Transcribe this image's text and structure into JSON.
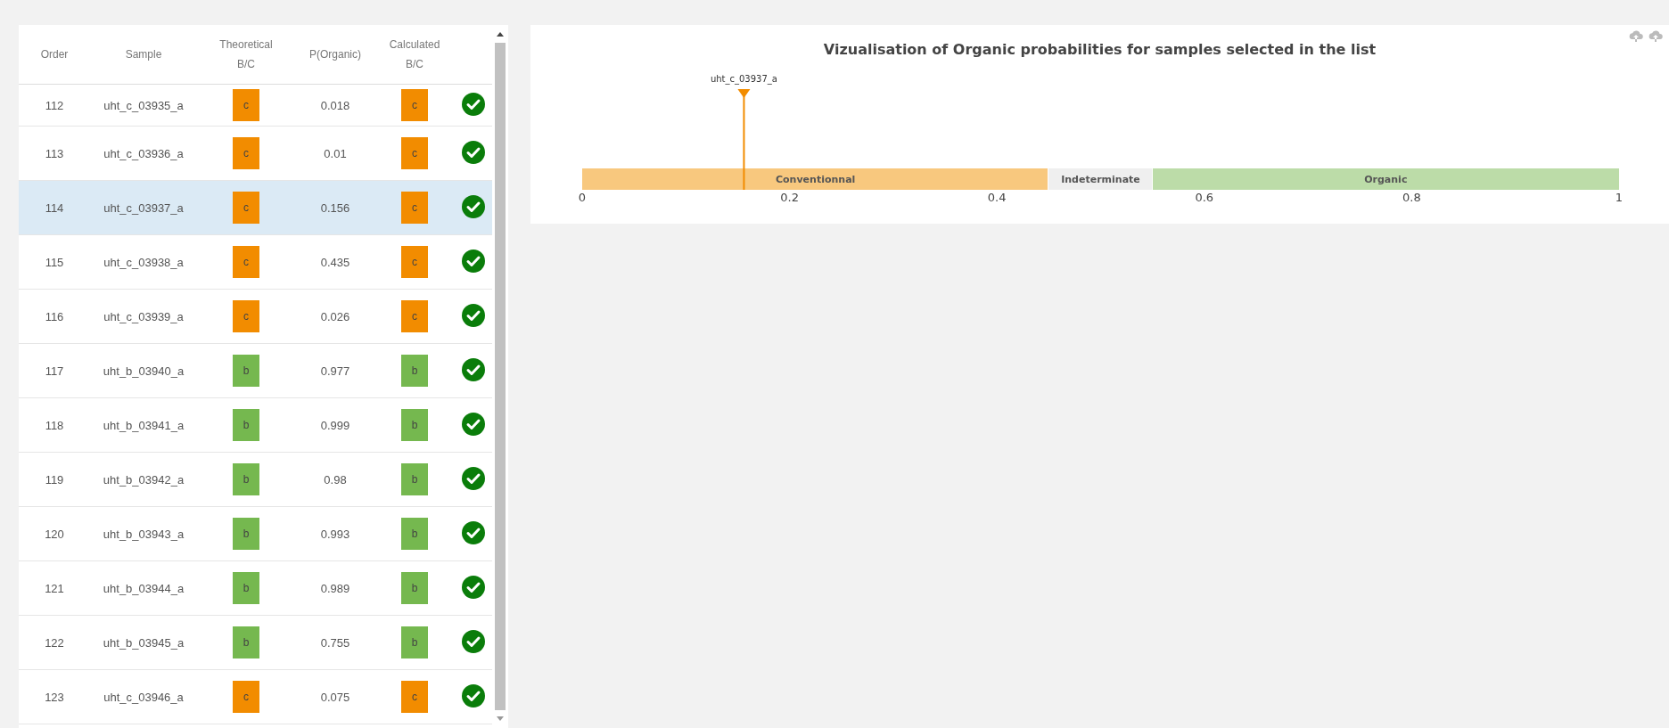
{
  "table": {
    "columns": [
      {
        "label": "Order"
      },
      {
        "label": "Sample"
      },
      {
        "label": "Theoretical B/C"
      },
      {
        "label": "P(Organic)"
      },
      {
        "label": "Calculated B/C"
      }
    ],
    "rows": [
      {
        "order": "112",
        "sample": "uht_c_03935_a",
        "theoretical": "c",
        "p_organic": "0.018",
        "calculated": "c",
        "match": true,
        "selected": false
      },
      {
        "order": "113",
        "sample": "uht_c_03936_a",
        "theoretical": "c",
        "p_organic": "0.01",
        "calculated": "c",
        "match": true,
        "selected": false
      },
      {
        "order": "114",
        "sample": "uht_c_03937_a",
        "theoretical": "c",
        "p_organic": "0.156",
        "calculated": "c",
        "match": true,
        "selected": true
      },
      {
        "order": "115",
        "sample": "uht_c_03938_a",
        "theoretical": "c",
        "p_organic": "0.435",
        "calculated": "c",
        "match": true,
        "selected": false
      },
      {
        "order": "116",
        "sample": "uht_c_03939_a",
        "theoretical": "c",
        "p_organic": "0.026",
        "calculated": "c",
        "match": true,
        "selected": false
      },
      {
        "order": "117",
        "sample": "uht_b_03940_a",
        "theoretical": "b",
        "p_organic": "0.977",
        "calculated": "b",
        "match": true,
        "selected": false
      },
      {
        "order": "118",
        "sample": "uht_b_03941_a",
        "theoretical": "b",
        "p_organic": "0.999",
        "calculated": "b",
        "match": true,
        "selected": false
      },
      {
        "order": "119",
        "sample": "uht_b_03942_a",
        "theoretical": "b",
        "p_organic": "0.98",
        "calculated": "b",
        "match": true,
        "selected": false
      },
      {
        "order": "120",
        "sample": "uht_b_03943_a",
        "theoretical": "b",
        "p_organic": "0.993",
        "calculated": "b",
        "match": true,
        "selected": false
      },
      {
        "order": "121",
        "sample": "uht_b_03944_a",
        "theoretical": "b",
        "p_organic": "0.989",
        "calculated": "b",
        "match": true,
        "selected": false
      },
      {
        "order": "122",
        "sample": "uht_b_03945_a",
        "theoretical": "b",
        "p_organic": "0.755",
        "calculated": "b",
        "match": true,
        "selected": false
      },
      {
        "order": "123",
        "sample": "uht_c_03946_a",
        "theoretical": "c",
        "p_organic": "0.075",
        "calculated": "c",
        "match": true,
        "selected": false
      }
    ]
  },
  "chart_panel": {
    "title": "Vizualisation of Organic probabilities for samples selected in the list",
    "markers": [
      {
        "label": "uht_c_03937_a",
        "level": 0.156
      }
    ],
    "bands": [
      {
        "label": "Conventionnal",
        "color": "#f8c87e"
      },
      {
        "label": "Indeterminate",
        "color": "#efefef"
      },
      {
        "label": "Organic",
        "color": "#bcdca8"
      }
    ],
    "band_limits": [
      {
        "level": 0.45
      },
      {
        "level": 0.55
      }
    ],
    "ticks": [
      {
        "label": "0",
        "level": 0
      },
      {
        "label": "0.2",
        "level": 0.2
      },
      {
        "label": "0.4",
        "level": 0.4
      },
      {
        "label": "0.6",
        "level": 0.6
      },
      {
        "label": "0.8",
        "level": 0.8
      },
      {
        "label": "1",
        "level": 1
      }
    ]
  }
}
